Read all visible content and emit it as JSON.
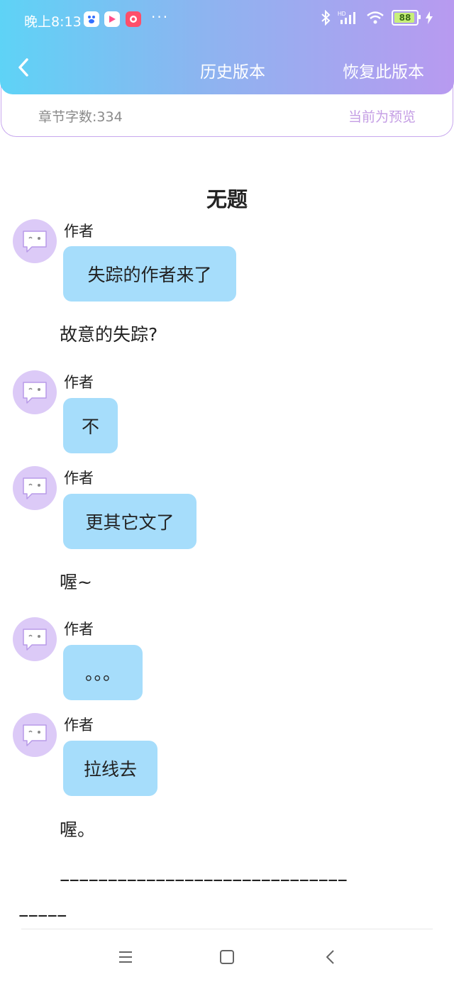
{
  "status_bar": {
    "time": "晚上8:13",
    "more": "···",
    "battery": "88"
  },
  "nav": {
    "title": "历史版本",
    "restore": "恢复此版本"
  },
  "info": {
    "word_count": "章节字数:334",
    "preview_status": "当前为预览"
  },
  "chapter": {
    "title": "无题",
    "messages": [
      {
        "type": "author",
        "name": "作者",
        "text": "失踪的作者来了"
      },
      {
        "type": "narration",
        "text": "故意的失踪?"
      },
      {
        "type": "author",
        "name": "作者",
        "text": "不"
      },
      {
        "type": "author",
        "name": "作者",
        "text": "更其它文了"
      },
      {
        "type": "narration",
        "text": "喔~"
      },
      {
        "type": "author",
        "name": "作者",
        "text": "。。。"
      },
      {
        "type": "author",
        "name": "作者",
        "text": "拉线去"
      },
      {
        "type": "narration",
        "text": "喔。"
      }
    ],
    "separator_line1": "––––––––––––––––––––––––––––––",
    "separator_line2": "–––––"
  },
  "colors": {
    "header_gradient_start": "#5ed3f6",
    "header_gradient_end": "#b89af0",
    "bubble": "#a6ddfb",
    "avatar_bg": "#dccaf7",
    "preview_label": "#c49de4"
  }
}
